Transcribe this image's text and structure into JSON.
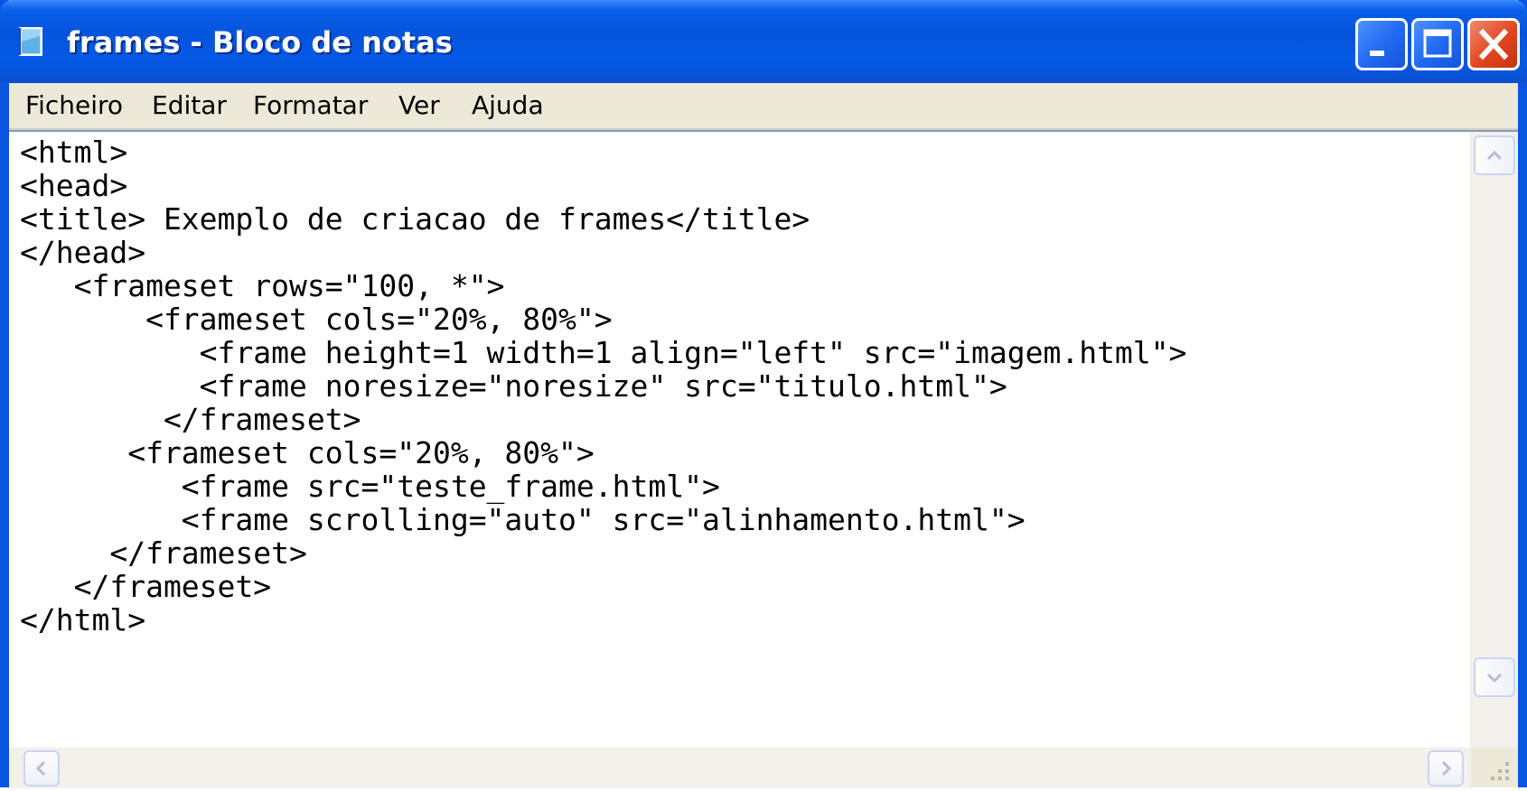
{
  "window": {
    "title": "frames - Bloco de notas",
    "icon": "notepad-icon",
    "controls": [
      "minimize-icon",
      "maximize-icon",
      "close-icon"
    ]
  },
  "menu": {
    "items": [
      {
        "label": "Ficheiro"
      },
      {
        "label": "Editar"
      },
      {
        "label": "Formatar"
      },
      {
        "label": "Ver"
      },
      {
        "label": "Ajuda"
      }
    ]
  },
  "editor": {
    "lines": [
      "<html>",
      "<head>",
      "<title> Exemplo de criacao de frames</title>",
      "</head>",
      "   <frameset rows=\"100, *\">",
      "       <frameset cols=\"20%, 80%\">",
      "          <frame height=1 width=1 align=\"left\" src=\"imagem.html\">",
      "          <frame noresize=\"noresize\" src=\"titulo.html\">",
      "        </frameset>",
      "      <frameset cols=\"20%, 80%\">",
      "         <frame src=\"teste_frame.html\">",
      "         <frame scrolling=\"auto\" src=\"alinhamento.html\">",
      "     </frameset>",
      "   </frameset>",
      "</html>"
    ]
  },
  "scrollbars": {
    "vertical": [
      "scroll-up-arrow-icon",
      "scroll-down-arrow-icon"
    ],
    "horizontal": [
      "scroll-left-arrow-icon",
      "scroll-right-arrow-icon"
    ],
    "grip": "resize-grip-icon"
  },
  "colors": {
    "titlebar": "#0654dd",
    "close_button": "#e0451f",
    "menu_background": "#ece9d8",
    "editor_background": "#ffffff"
  }
}
